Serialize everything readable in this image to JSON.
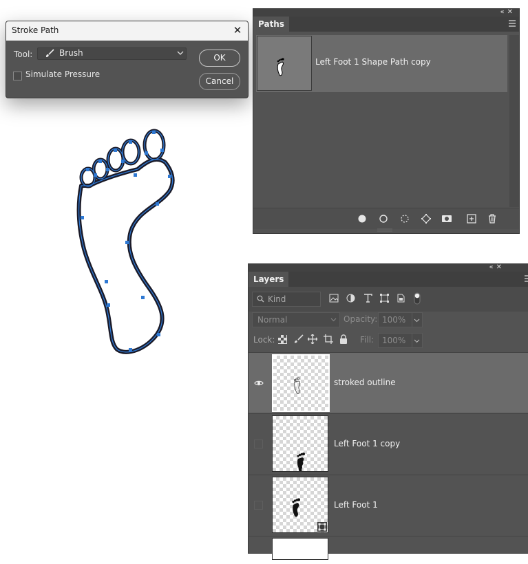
{
  "colors": {
    "panel_bg": "#535353",
    "selected_row": "#6b6b6b",
    "anchor_blue": "#2f79d3",
    "stroke_dark": "#1a1a28"
  },
  "stroke_dialog": {
    "title": "Stroke Path",
    "tool_label": "Tool:",
    "tool_value": "Brush",
    "simulate_pressure_label": "Simulate Pressure",
    "simulate_pressure_checked": false,
    "ok_label": "OK",
    "cancel_label": "Cancel"
  },
  "paths_panel": {
    "tab": "Paths",
    "items": [
      {
        "name": "Left Foot 1 Shape Path copy",
        "selected": true
      }
    ],
    "footer_icons": [
      "fill-path-icon",
      "stroke-path-icon",
      "load-selection-icon",
      "make-work-path-icon",
      "add-mask-icon",
      "new-path-icon",
      "delete-path-icon"
    ]
  },
  "layers_panel": {
    "tab": "Layers",
    "kind_placeholder": "Kind",
    "blend_mode": "Normal",
    "opacity_label": "Opacity:",
    "opacity_value": "100%",
    "lock_label": "Lock:",
    "fill_label": "Fill:",
    "fill_value": "100%",
    "layers": [
      {
        "name": "stroked outline",
        "visible": true,
        "selected": true
      },
      {
        "name": "Left Foot 1 copy",
        "visible": false,
        "selected": false
      },
      {
        "name": "Left Foot 1",
        "visible": false,
        "selected": false,
        "badge": "shape-layer-icon"
      }
    ]
  }
}
